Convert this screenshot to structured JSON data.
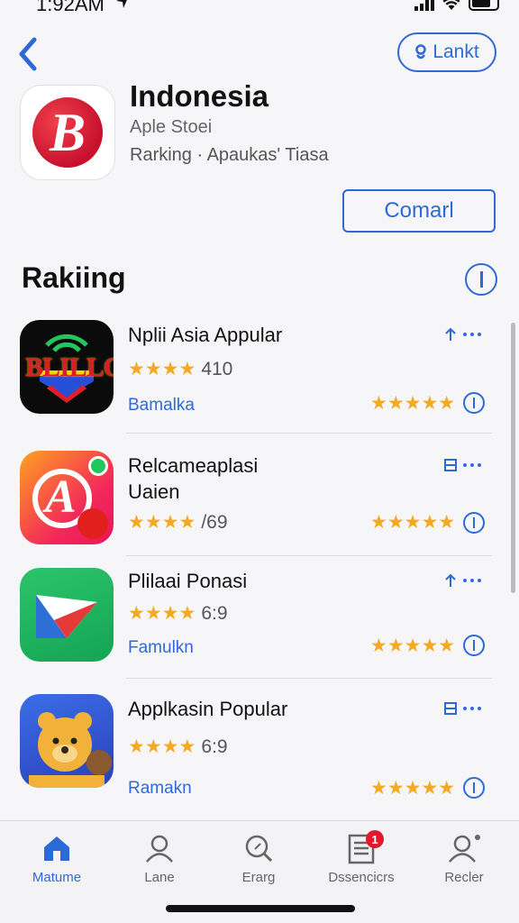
{
  "status_bar": {
    "time": "1:92AM",
    "location_icon": "location-arrow-icon"
  },
  "header": {
    "back_icon": "chevron-left-icon",
    "lankt_label": "Lankt",
    "app_title": "Indonesia",
    "app_subtitle": "Aple Stoei",
    "app_meta": "Rarking · Apaukas' Tiasa",
    "logo_letter": "B",
    "comarl_label": "Comarl"
  },
  "section": {
    "title": "Rakiing"
  },
  "apps": [
    {
      "name_line1": "Nplii Asia Appular",
      "name_line2": "",
      "stars": "★★★★",
      "rating": "410",
      "category": "Bamalka",
      "right_stars": "★★★★★",
      "action_icon": "share-icon",
      "icon_text": "BLILLO"
    },
    {
      "name_line1": "Relcameaplasi",
      "name_line2": "Uaien",
      "stars": "★★★★",
      "rating": "/69",
      "category": "",
      "right_stars": "★★★★★",
      "action_icon": "list-icon",
      "icon_text": "A"
    },
    {
      "name_line1": "Plilaai Ponasi",
      "name_line2": "",
      "stars": "★★★★",
      "rating": "6:9",
      "category": "Famulkn",
      "right_stars": "★★★★★",
      "action_icon": "share-icon",
      "icon_text": ""
    },
    {
      "name_line1": "Applkasin Popular",
      "name_line2": "",
      "stars": "★★★★",
      "rating": "6:9",
      "category": "Ramakn",
      "right_stars": "★★★★★",
      "action_icon": "list-icon",
      "icon_text": ""
    }
  ],
  "tabbar": {
    "tabs": [
      {
        "label": "Matume",
        "icon": "home-icon",
        "active": true
      },
      {
        "label": "Lane",
        "icon": "person-icon",
        "active": false
      },
      {
        "label": "Erarg",
        "icon": "search-icon",
        "active": false
      },
      {
        "label": "Dssencicrs",
        "icon": "news-icon",
        "active": false,
        "badge": "1"
      },
      {
        "label": "Recler",
        "icon": "account-icon",
        "active": false
      }
    ]
  },
  "colors": {
    "accent": "#2d6ad8",
    "star": "#f4a920",
    "badge": "#e01a2a"
  }
}
